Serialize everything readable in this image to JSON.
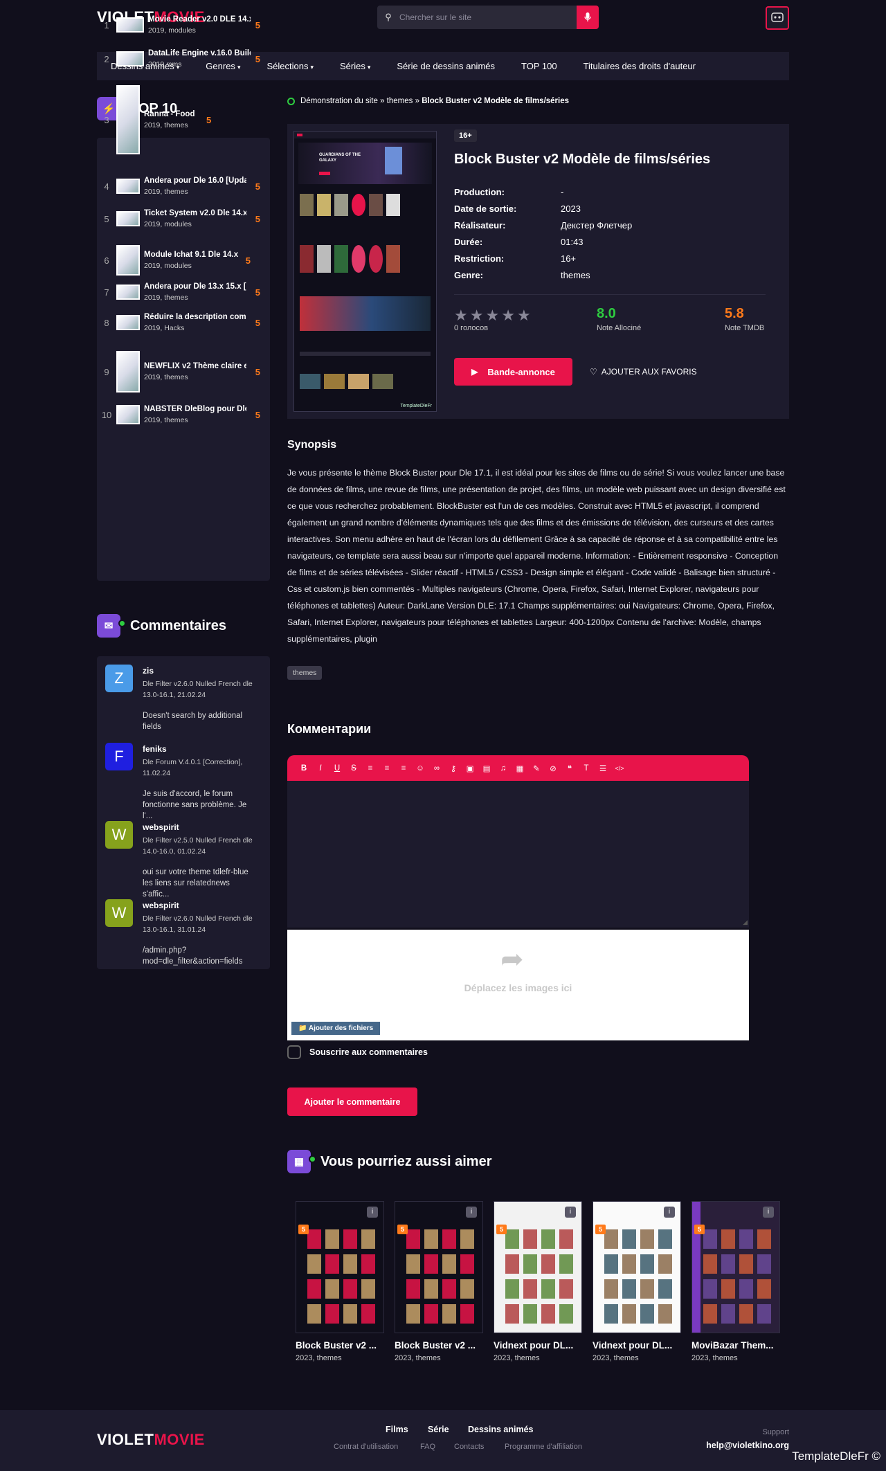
{
  "header": {
    "logo_a": "VIOLET",
    "logo_b": "MOVIE",
    "search_placeholder": "Chercher sur le site"
  },
  "nav": [
    {
      "label": "Dessins animés",
      "dd": true
    },
    {
      "label": "Genres",
      "dd": true
    },
    {
      "label": "Sélections",
      "dd": true
    },
    {
      "label": "Séries",
      "dd": true
    },
    {
      "label": "Série de dessins animés",
      "dd": false
    },
    {
      "label": "TOP 100",
      "dd": false
    },
    {
      "label": "Titulaires des droits d'auteur",
      "dd": false
    }
  ],
  "top10": {
    "title": "TOP 10",
    "items": [
      {
        "n": "1",
        "title": "Movie Reader v2.0 DLE 14.x",
        "sub": "2019, modules",
        "score": "5"
      },
      {
        "n": "2",
        "title": "DataLife Engine v.16.0 Build",
        "sub": "2019, cms",
        "score": "5"
      },
      {
        "n": "3",
        "title": "Ranna - Food",
        "sub": "2019, themes",
        "score": "5"
      },
      {
        "n": "4",
        "title": "Andera pour Dle 16.0 [Upda",
        "sub": "2019, themes",
        "score": "5"
      },
      {
        "n": "5",
        "title": "Ticket System v2.0 Dle 14.x",
        "sub": "2019, modules",
        "score": "5"
      },
      {
        "n": "6",
        "title": "Module Ichat 9.1 Dle 14.x",
        "sub": "2019, modules",
        "score": "5"
      },
      {
        "n": "7",
        "title": "Andera pour Dle 13.x 15.x [U",
        "sub": "2019, themes",
        "score": "5"
      },
      {
        "n": "8",
        "title": "Réduire la description comp",
        "sub": "2019, Hacks",
        "score": "5"
      },
      {
        "n": "9",
        "title": "NEWFLIX v2 Thème claire e",
        "sub": "2019, themes",
        "score": "5"
      },
      {
        "n": "10",
        "title": "NABSTER DleBlog pour Dle",
        "sub": "2019, themes",
        "score": "5"
      }
    ]
  },
  "comments": {
    "title": "Commentaires",
    "items": [
      {
        "letter": "Z",
        "color": "#4a9be8",
        "name": "zis",
        "topic": "Dle Filter v2.6.0 Nulled French dle 13.0-16.1, 21.02.24",
        "text": "Doesn't search by additional fields"
      },
      {
        "letter": "F",
        "color": "#1f1fe0",
        "name": "feniks",
        "topic": "Dle Forum V.4.0.1 [Correction], 11.02.24",
        "text": "Je suis d'accord, le forum fonctionne sans problème. Je l'..."
      },
      {
        "letter": "W",
        "color": "#86a21c",
        "name": "webspirit",
        "topic": "Dle Filter v2.5.0 Nulled French dle 14.0-16.0, 01.02.24",
        "text": "oui sur votre theme tdlefr-blue les liens sur relatednews s'affic..."
      },
      {
        "letter": "W",
        "color": "#86a21c",
        "name": "webspirit",
        "topic": "Dle Filter v2.6.0 Nulled French dle 13.0-16.1, 31.01.24",
        "text": "/admin.php?mod=dle_filter&action=fields"
      }
    ]
  },
  "breadcrumb": {
    "a": "Démonstration du site",
    "b": "themes",
    "c": "Block Buster v2 Modèle de films/séries"
  },
  "movie": {
    "age": "16+",
    "title": "Block Buster v2 Modèle de films/séries",
    "meta": [
      {
        "k": "Production:",
        "v": "-"
      },
      {
        "k": "Date de sortie:",
        "v": "2023"
      },
      {
        "k": "Réalisateur:",
        "v": "Декстер Флетчер"
      },
      {
        "k": "Durée:",
        "v": "01:43"
      },
      {
        "k": "Restriction:",
        "v": "16+"
      },
      {
        "k": "Genre:",
        "v": "themes"
      }
    ],
    "votes": "0 голосов",
    "allocine": "8.0",
    "allocine_label": "Note Allociné",
    "tmdb": "5.8",
    "tmdb_label": "Note TMDB",
    "trailer": "Bande-annonce",
    "fav": "AJOUTER AUX FAVORIS",
    "poster_text": "GUARDIANS OF THE GALAXY",
    "poster_mark": "TemplateDleFr"
  },
  "synopsis": {
    "title": "Synopsis",
    "text": "Je vous présente le thème Block Buster pour Dle 17.1, il est idéal pour les sites de films ou de série! Si vous voulez lancer une base de données de films, une revue de films, une présentation de projet, des films, un modèle web puissant avec un design diversifié est ce que vous recherchez probablement. BlockBuster est l'un de ces modèles. Construit avec HTML5 et javascript, il comprend également un grand nombre d'éléments dynamiques tels que des films et des émissions de télévision, des curseurs et des cartes interactives. Son menu adhère en haut de l'écran lors du défilement Grâce à sa capacité de réponse et à sa compatibilité entre les navigateurs, ce template sera aussi beau sur n'importe quel appareil moderne. Information: - Entièrement responsive - Conception de films et de séries télévisées - Slider réactif - HTML5 / CSS3 - Design simple et élégant - Code validé - Balisage bien structuré - Css et custom.js bien commentés - Multiples navigateurs (Chrome, Opera, Firefox, Safari, Internet Explorer, navigateurs pour téléphones et tablettes) Auteur: DarkLane Version DLE: 17.1 Champs supplémentaires: oui Navigateurs: Chrome, Opera, Firefox, Safari, Internet Explorer, navigateurs pour téléphones et tablettes Largeur: 400-1200px Contenu de l'archive: Modèle, champs supplémentaires, plugin",
    "tag": "themes"
  },
  "comment_form": {
    "title": "Комментарии",
    "drop": "Déplacez les images ici",
    "add_files": "Ajouter des fichiers",
    "subscribe": "Souscrire aux commentaires",
    "submit": "Ajouter le commentaire"
  },
  "related": {
    "title": "Vous pourriez aussi aimer",
    "items": [
      {
        "title": "Block Buster v2 ...",
        "sub": "2023, themes",
        "badge": "5",
        "style": "dark"
      },
      {
        "title": "Block Buster v2 ...",
        "sub": "2023, themes",
        "badge": "5",
        "style": "dark"
      },
      {
        "title": "Vidnext pour DL...",
        "sub": "2023, themes",
        "badge": "5",
        "style": "light"
      },
      {
        "title": "Vidnext pour DL...",
        "sub": "2023, themes",
        "badge": "5",
        "style": "white"
      },
      {
        "title": "MoviBazar Them...",
        "sub": "2023, themes",
        "badge": "5",
        "style": "purple"
      }
    ]
  },
  "footer": {
    "links": [
      "Films",
      "Série",
      "Dessins animés"
    ],
    "sublinks": [
      "Contrat d'utilisation",
      "FAQ",
      "Contacts",
      "Programme d'affiliation"
    ],
    "support": "Support",
    "email": "help@violetkino.org",
    "watermark": "TemplateDleFr ©"
  },
  "colors": {
    "accent": "#e8144a",
    "bg": "#110f1c",
    "panel": "#1d1b2d",
    "score": "#ff7a1a",
    "green": "#2ecc40"
  }
}
